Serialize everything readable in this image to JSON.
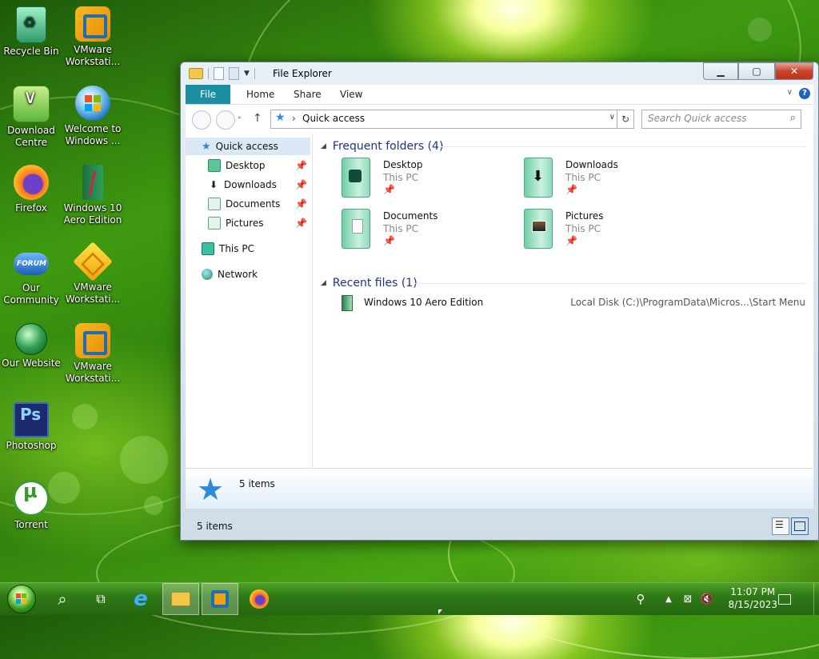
{
  "desktop": {
    "icons": [
      {
        "label": "Recycle Bin"
      },
      {
        "label": "VMware Workstati..."
      },
      {
        "label": "Download Centre"
      },
      {
        "label": "Welcome to Windows ..."
      },
      {
        "label": "Firefox"
      },
      {
        "label": "Windows 10 Aero Edition"
      },
      {
        "label": "Our Community"
      },
      {
        "label": "VMware Workstati..."
      },
      {
        "label": "Our Website"
      },
      {
        "label": "VMware Workstati..."
      },
      {
        "label": "Photoshop"
      },
      {
        "label": "Torrent"
      }
    ],
    "forum_badge": "FORUM"
  },
  "window": {
    "title": "File Explorer",
    "ribbon_tabs": [
      "File",
      "Home",
      "Share",
      "View"
    ],
    "address": {
      "separator": "›",
      "location": "Quick access"
    },
    "search": {
      "placeholder": "Search Quick access"
    },
    "nav_pane": {
      "quick_access": "Quick access",
      "pinned": [
        "Desktop",
        "Downloads",
        "Documents",
        "Pictures"
      ],
      "this_pc": "This PC",
      "network": "Network"
    },
    "frequent_folders": {
      "header": "Frequent folders (4)",
      "items": [
        {
          "name": "Desktop",
          "location": "This PC"
        },
        {
          "name": "Downloads",
          "location": "This PC"
        },
        {
          "name": "Documents",
          "location": "This PC"
        },
        {
          "name": "Pictures",
          "location": "This PC"
        }
      ]
    },
    "recent_files": {
      "header": "Recent files (1)",
      "items": [
        {
          "name": "Windows 10 Aero Edition",
          "path": "Local Disk (C:)\\ProgramData\\Micros...\\Start Menu"
        }
      ]
    },
    "details_pane": {
      "text": "5 items"
    },
    "status": {
      "text": "5 items"
    }
  },
  "taskbar": {
    "time": "11:07 PM",
    "date": "8/15/2023"
  },
  "colors": {
    "ribbon_file_tab": "#1c8fa3",
    "group_header": "#1e3287",
    "close_button": "#c13318",
    "taskbar": "#2f7a16"
  }
}
